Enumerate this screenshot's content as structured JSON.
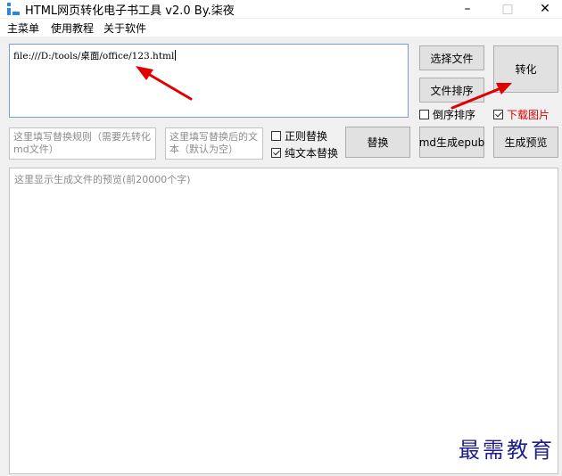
{
  "window": {
    "title": "HTML网页转化电子书工具 v2.0 By.柒夜",
    "minimize_glyph": "–",
    "maximize_glyph": "□",
    "close_glyph": "✕"
  },
  "menu": [
    "主菜单",
    "使用教程",
    "关于软件"
  ],
  "url_input": {
    "value": "file:///D:/tools/桌面/office/123.html"
  },
  "buttons": {
    "select_file": "选择文件",
    "convert": "转化",
    "sort_files": "文件排序",
    "replace": "替换",
    "md_to_epub": "md生成epub",
    "generate_preview": "生成预览"
  },
  "checkboxes": {
    "reverse_sort": {
      "label": "倒序排序",
      "checked": false
    },
    "download_images": {
      "label": "下载图片",
      "checked": true
    },
    "regex_replace": {
      "label": "正则替换",
      "checked": false
    },
    "plain_text_replace": {
      "label": "纯文本替换",
      "checked": true
    }
  },
  "rule_input": {
    "placeholder": "这里填写替换规则（需要先转化md文件）"
  },
  "replacement_input": {
    "placeholder": "这里填写替换后的文本（默认为空）"
  },
  "preview": {
    "placeholder": "这里显示生成文件的预览(前20000个字)"
  },
  "watermark": "最需教育",
  "colors": {
    "accent_red": "#e00000",
    "input_border_focus": "#7a9cd3",
    "watermark": "#1f1f8c"
  }
}
